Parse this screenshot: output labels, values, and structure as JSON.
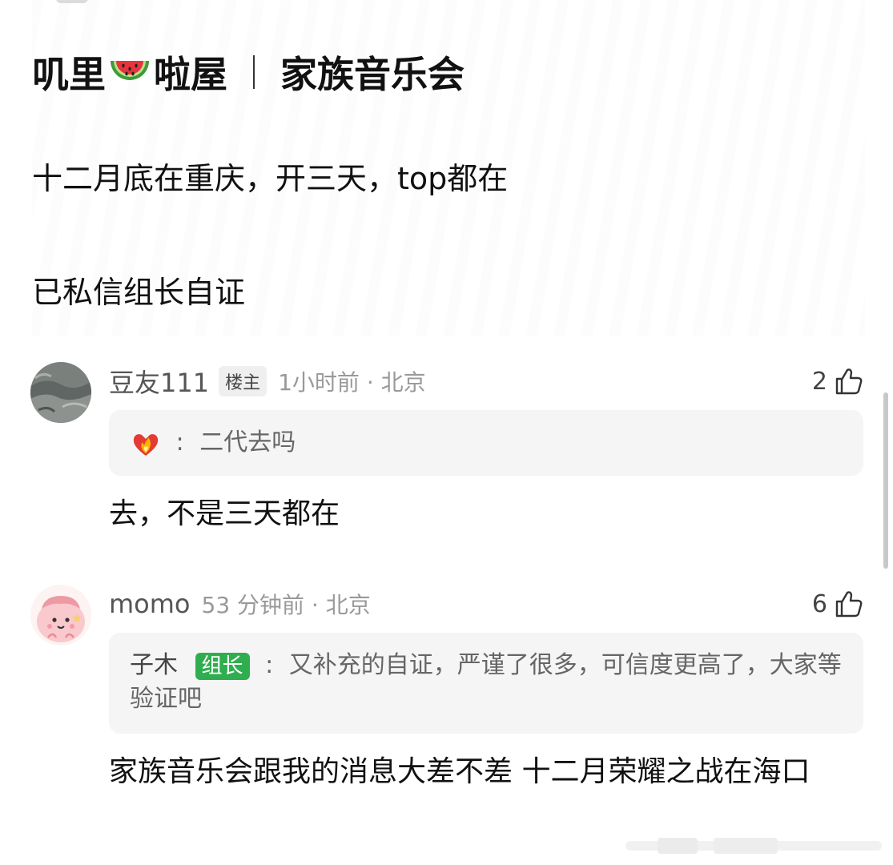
{
  "header": {
    "group_name_part1": "叽里",
    "group_name_part2": "啦屋",
    "group_name_icon": "watermelon-icon",
    "topic": "家族音乐会"
  },
  "post": {
    "line1": "十二月底在重庆，开三天，top都在",
    "line2": "已私信组长自证"
  },
  "comments": [
    {
      "username": "豆友111",
      "badge": "楼主",
      "time": "1小时前 · 北京",
      "likes": "2",
      "quote_icon": "burning-heart-icon",
      "quote_text": "二代去吗",
      "reply": "去，不是三天都在"
    },
    {
      "username": "momo",
      "time": "53 分钟前 · 北京",
      "likes": "6",
      "quote_user": "子木",
      "quote_badge": "组长",
      "quote_text": "又补充的自证，严谨了很多，可信度更高了，大家等验证吧",
      "reply": "家族音乐会跟我的消息大差不差 十二月荣耀之战在海口"
    }
  ],
  "colors": {
    "accent_green": "#2fae4f",
    "text_primary": "#111111",
    "text_muted": "#999999",
    "quote_bg": "#f5f5f5"
  }
}
